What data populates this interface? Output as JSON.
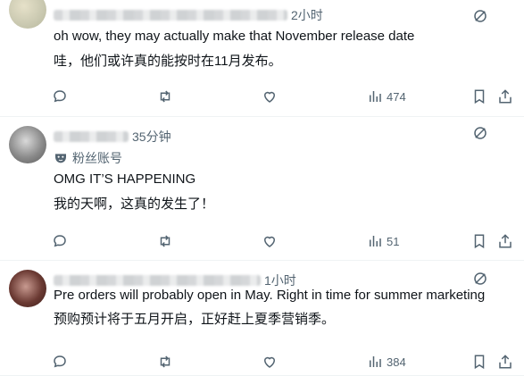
{
  "posts": [
    {
      "time": "2小时",
      "text_en": "oh wow, they may actually make that November release date",
      "text_cn": "哇，他们或许真的能按时在11月发布。",
      "views": "474"
    },
    {
      "time": "35分钟",
      "badge": "粉丝账号",
      "text_en": "OMG IT’S HAPPENING",
      "text_cn": "我的天啊，这真的发生了！",
      "views": "51"
    },
    {
      "time": "1小时",
      "text_en": "Pre orders will probably open in May. Right in time for summer marketing",
      "text_cn": "预购预计将于五月开启，正好赶上夏季营销季。",
      "views": "384"
    }
  ],
  "icons": {
    "reply": "reply-icon",
    "repost": "repost-icon",
    "like": "like-icon",
    "views": "views-icon",
    "bookmark": "bookmark-icon",
    "share": "share-icon",
    "more": "grok-icon"
  }
}
